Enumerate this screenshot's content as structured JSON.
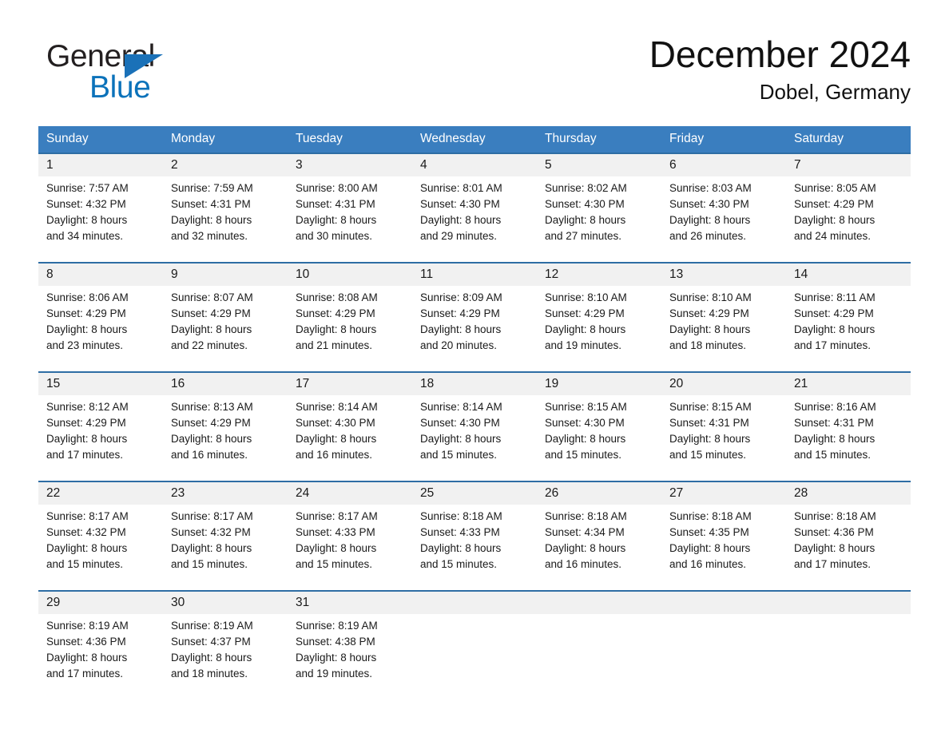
{
  "brand": {
    "line1": "General",
    "line2": "Blue",
    "triangle_color": "#1a71b8",
    "text_color": "#231f20",
    "blue_text_color": "#0b72ba"
  },
  "header": {
    "month_title": "December 2024",
    "location": "Dobel, Germany"
  },
  "theme": {
    "header_bg": "#3a7ebf",
    "header_text": "#ffffff",
    "row_separator": "#2e6da4",
    "date_band_bg": "#f1f1f1",
    "page_bg": "#ffffff"
  },
  "calendar": {
    "weekday_headers": [
      "Sunday",
      "Monday",
      "Tuesday",
      "Wednesday",
      "Thursday",
      "Friday",
      "Saturday"
    ],
    "weeks": [
      {
        "days": [
          {
            "date": "1",
            "info": "Sunrise: 7:57 AM\nSunset: 4:32 PM\nDaylight: 8 hours\nand 34 minutes."
          },
          {
            "date": "2",
            "info": "Sunrise: 7:59 AM\nSunset: 4:31 PM\nDaylight: 8 hours\nand 32 minutes."
          },
          {
            "date": "3",
            "info": "Sunrise: 8:00 AM\nSunset: 4:31 PM\nDaylight: 8 hours\nand 30 minutes."
          },
          {
            "date": "4",
            "info": "Sunrise: 8:01 AM\nSunset: 4:30 PM\nDaylight: 8 hours\nand 29 minutes."
          },
          {
            "date": "5",
            "info": "Sunrise: 8:02 AM\nSunset: 4:30 PM\nDaylight: 8 hours\nand 27 minutes."
          },
          {
            "date": "6",
            "info": "Sunrise: 8:03 AM\nSunset: 4:30 PM\nDaylight: 8 hours\nand 26 minutes."
          },
          {
            "date": "7",
            "info": "Sunrise: 8:05 AM\nSunset: 4:29 PM\nDaylight: 8 hours\nand 24 minutes."
          }
        ]
      },
      {
        "days": [
          {
            "date": "8",
            "info": "Sunrise: 8:06 AM\nSunset: 4:29 PM\nDaylight: 8 hours\nand 23 minutes."
          },
          {
            "date": "9",
            "info": "Sunrise: 8:07 AM\nSunset: 4:29 PM\nDaylight: 8 hours\nand 22 minutes."
          },
          {
            "date": "10",
            "info": "Sunrise: 8:08 AM\nSunset: 4:29 PM\nDaylight: 8 hours\nand 21 minutes."
          },
          {
            "date": "11",
            "info": "Sunrise: 8:09 AM\nSunset: 4:29 PM\nDaylight: 8 hours\nand 20 minutes."
          },
          {
            "date": "12",
            "info": "Sunrise: 8:10 AM\nSunset: 4:29 PM\nDaylight: 8 hours\nand 19 minutes."
          },
          {
            "date": "13",
            "info": "Sunrise: 8:10 AM\nSunset: 4:29 PM\nDaylight: 8 hours\nand 18 minutes."
          },
          {
            "date": "14",
            "info": "Sunrise: 8:11 AM\nSunset: 4:29 PM\nDaylight: 8 hours\nand 17 minutes."
          }
        ]
      },
      {
        "days": [
          {
            "date": "15",
            "info": "Sunrise: 8:12 AM\nSunset: 4:29 PM\nDaylight: 8 hours\nand 17 minutes."
          },
          {
            "date": "16",
            "info": "Sunrise: 8:13 AM\nSunset: 4:29 PM\nDaylight: 8 hours\nand 16 minutes."
          },
          {
            "date": "17",
            "info": "Sunrise: 8:14 AM\nSunset: 4:30 PM\nDaylight: 8 hours\nand 16 minutes."
          },
          {
            "date": "18",
            "info": "Sunrise: 8:14 AM\nSunset: 4:30 PM\nDaylight: 8 hours\nand 15 minutes."
          },
          {
            "date": "19",
            "info": "Sunrise: 8:15 AM\nSunset: 4:30 PM\nDaylight: 8 hours\nand 15 minutes."
          },
          {
            "date": "20",
            "info": "Sunrise: 8:15 AM\nSunset: 4:31 PM\nDaylight: 8 hours\nand 15 minutes."
          },
          {
            "date": "21",
            "info": "Sunrise: 8:16 AM\nSunset: 4:31 PM\nDaylight: 8 hours\nand 15 minutes."
          }
        ]
      },
      {
        "days": [
          {
            "date": "22",
            "info": "Sunrise: 8:17 AM\nSunset: 4:32 PM\nDaylight: 8 hours\nand 15 minutes."
          },
          {
            "date": "23",
            "info": "Sunrise: 8:17 AM\nSunset: 4:32 PM\nDaylight: 8 hours\nand 15 minutes."
          },
          {
            "date": "24",
            "info": "Sunrise: 8:17 AM\nSunset: 4:33 PM\nDaylight: 8 hours\nand 15 minutes."
          },
          {
            "date": "25",
            "info": "Sunrise: 8:18 AM\nSunset: 4:33 PM\nDaylight: 8 hours\nand 15 minutes."
          },
          {
            "date": "26",
            "info": "Sunrise: 8:18 AM\nSunset: 4:34 PM\nDaylight: 8 hours\nand 16 minutes."
          },
          {
            "date": "27",
            "info": "Sunrise: 8:18 AM\nSunset: 4:35 PM\nDaylight: 8 hours\nand 16 minutes."
          },
          {
            "date": "28",
            "info": "Sunrise: 8:18 AM\nSunset: 4:36 PM\nDaylight: 8 hours\nand 17 minutes."
          }
        ]
      },
      {
        "days": [
          {
            "date": "29",
            "info": "Sunrise: 8:19 AM\nSunset: 4:36 PM\nDaylight: 8 hours\nand 17 minutes."
          },
          {
            "date": "30",
            "info": "Sunrise: 8:19 AM\nSunset: 4:37 PM\nDaylight: 8 hours\nand 18 minutes."
          },
          {
            "date": "31",
            "info": "Sunrise: 8:19 AM\nSunset: 4:38 PM\nDaylight: 8 hours\nand 19 minutes."
          },
          {
            "date": "",
            "info": ""
          },
          {
            "date": "",
            "info": ""
          },
          {
            "date": "",
            "info": ""
          },
          {
            "date": "",
            "info": ""
          }
        ]
      }
    ]
  }
}
